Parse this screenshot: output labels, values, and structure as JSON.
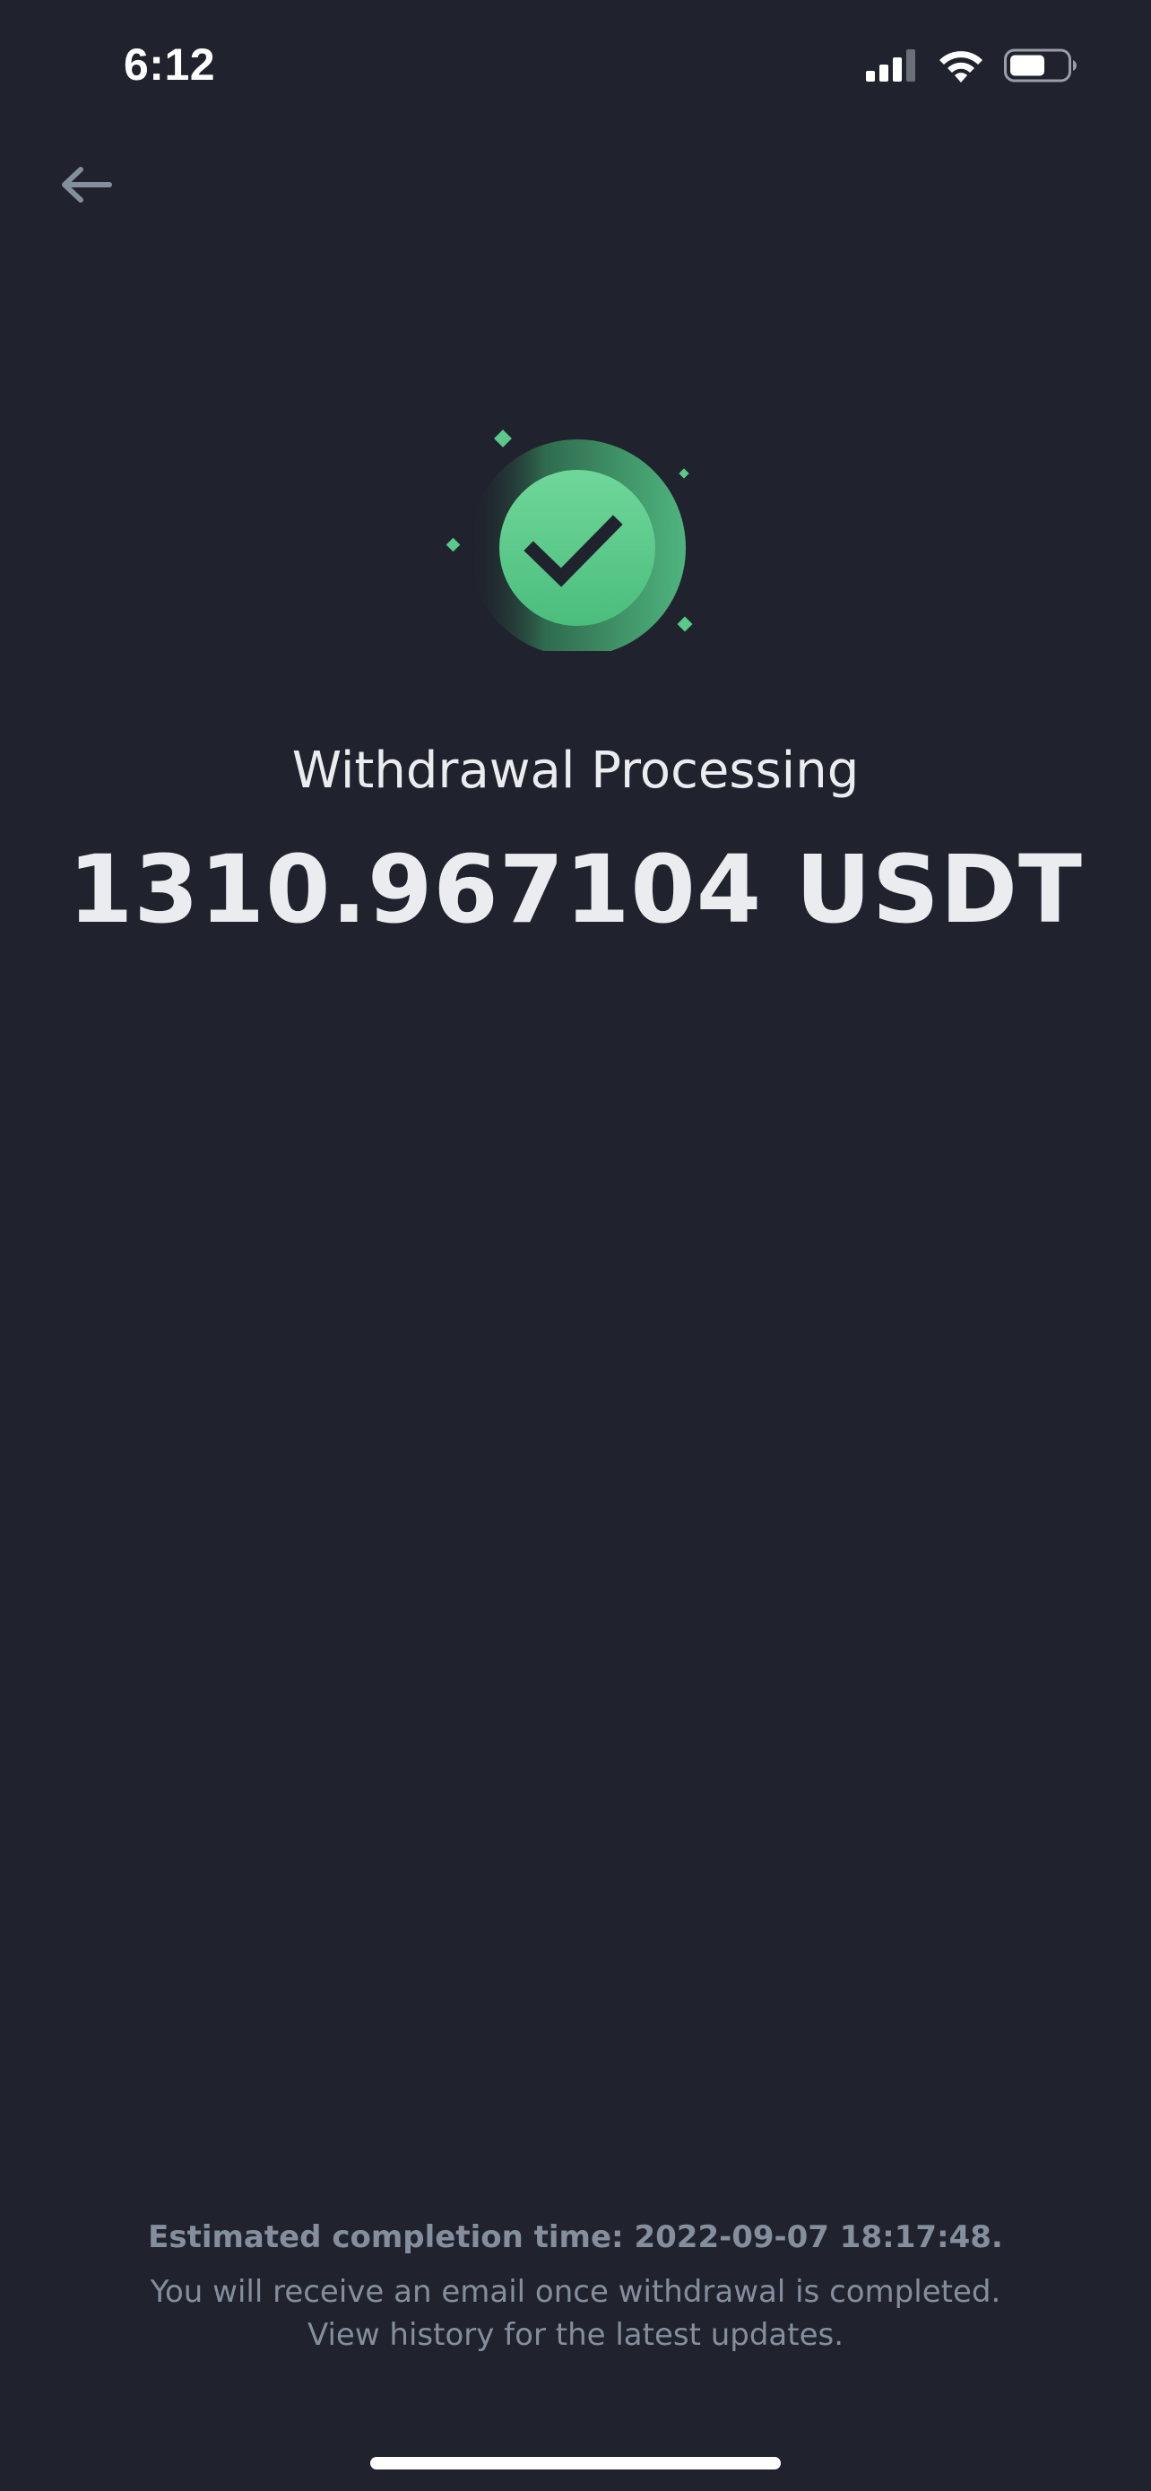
{
  "status_bar": {
    "time": "6:12",
    "icons": [
      "cellular-signal-icon",
      "wifi-icon",
      "battery-icon"
    ]
  },
  "header": {
    "back_icon": "arrow-left-icon"
  },
  "result": {
    "icon": "check-circle-icon",
    "title": "Withdrawal Processing",
    "amount": "1310.967104 USDT"
  },
  "footer": {
    "estimated_completion": "Estimated completion time: 2022-09-07 18:17:48.",
    "email_note": "You will receive an email once withdrawal is completed.",
    "history_note": "View history for the latest updates."
  },
  "colors": {
    "background": "#20232d",
    "success_green": "#5ac98a",
    "text_primary": "#eaecef",
    "text_secondary": "#848e9c"
  }
}
